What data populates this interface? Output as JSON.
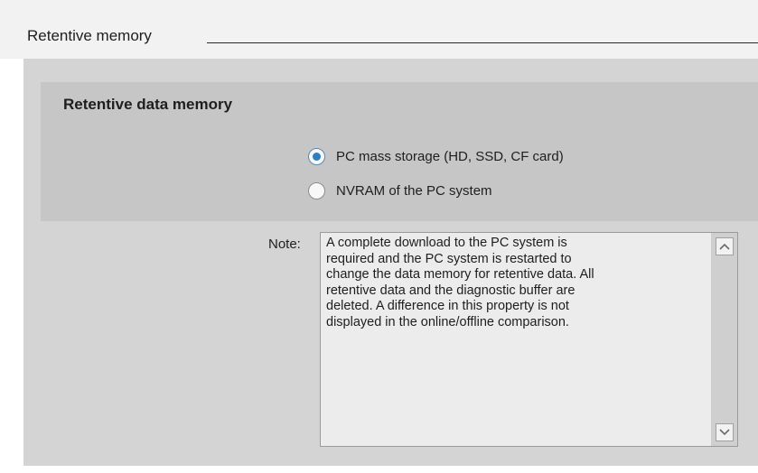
{
  "section": {
    "title": "Retentive memory"
  },
  "group": {
    "title": "Retentive data memory",
    "options": [
      {
        "label": "PC mass storage (HD, SSD, CF card)",
        "selected": true
      },
      {
        "label": "NVRAM of the PC system",
        "selected": false
      }
    ]
  },
  "note": {
    "label": "Note:",
    "text": "A complete download to the PC system is\nrequired and the PC system is restarted to\nchange the data memory for retentive data. All\nretentive data and the diagnostic buffer are\ndeleted. A difference in this property is not\ndisplayed in the online/offline comparison."
  },
  "icons": {
    "scroll_up": "chevron-up-icon",
    "scroll_down": "chevron-down-icon"
  },
  "colors": {
    "radio_selected": "#2a7fc4",
    "panel_background": "#d4d4d4",
    "group_background": "#c6c6c6"
  }
}
